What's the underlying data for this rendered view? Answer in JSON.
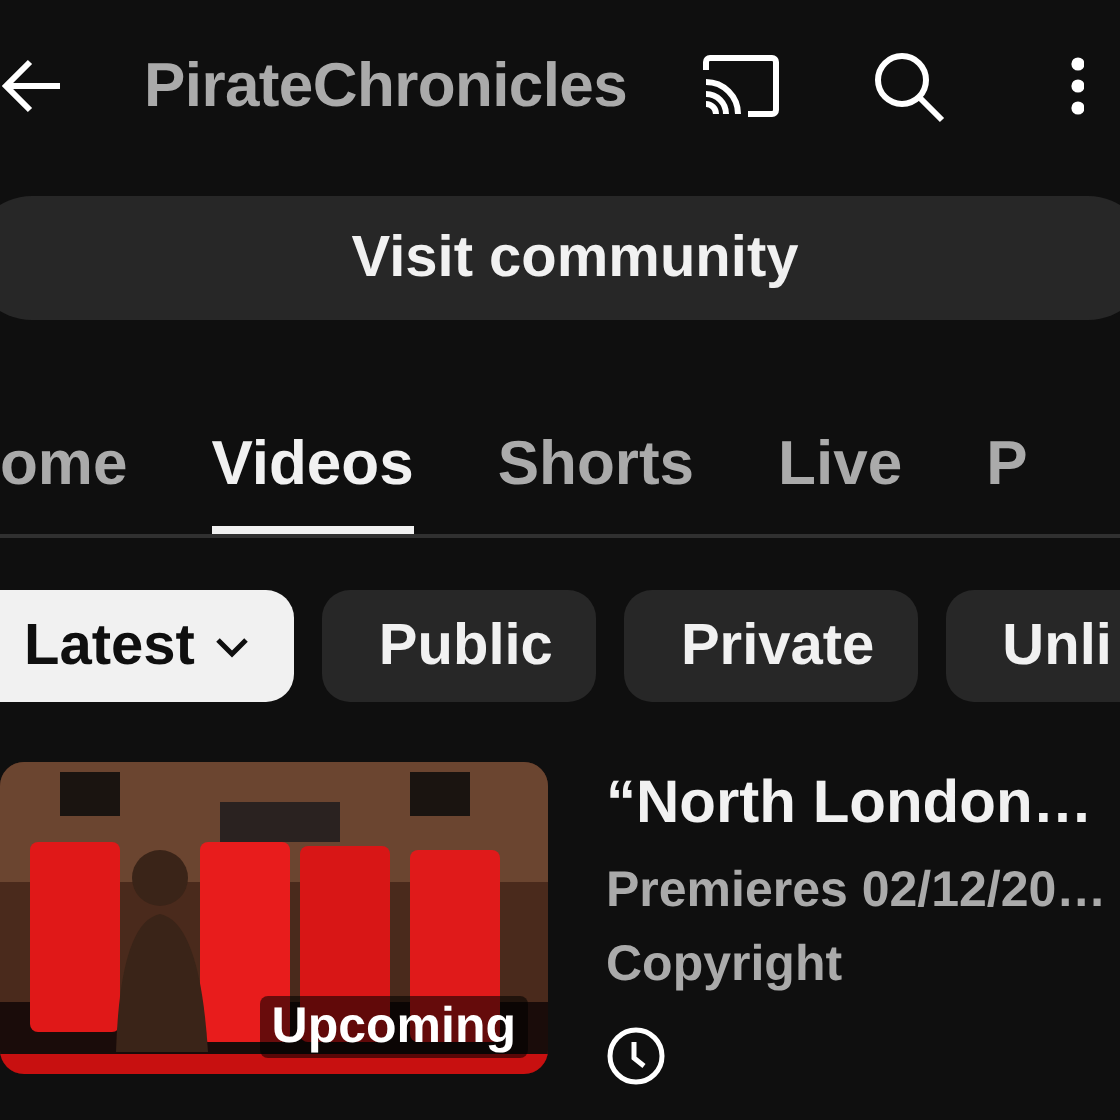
{
  "header": {
    "title": "PirateChronicles"
  },
  "community_button": {
    "label": "Visit community"
  },
  "tabs": [
    {
      "label": "ome",
      "selected": false
    },
    {
      "label": "Videos",
      "selected": true
    },
    {
      "label": "Shorts",
      "selected": false
    },
    {
      "label": "Live",
      "selected": false
    },
    {
      "label": "P",
      "selected": false
    }
  ],
  "filters": [
    {
      "label": "Latest",
      "selected": true,
      "dropdown": true
    },
    {
      "label": "Public",
      "selected": false,
      "dropdown": false
    },
    {
      "label": "Private",
      "selected": false,
      "dropdown": false
    },
    {
      "label": "Unli",
      "selected": false,
      "dropdown": false
    }
  ],
  "videos": [
    {
      "title": "“North London…",
      "meta": [
        "Premieres 02/12/20…",
        "Copyright"
      ],
      "badge": "Upcoming",
      "scheduled": true
    }
  ]
}
